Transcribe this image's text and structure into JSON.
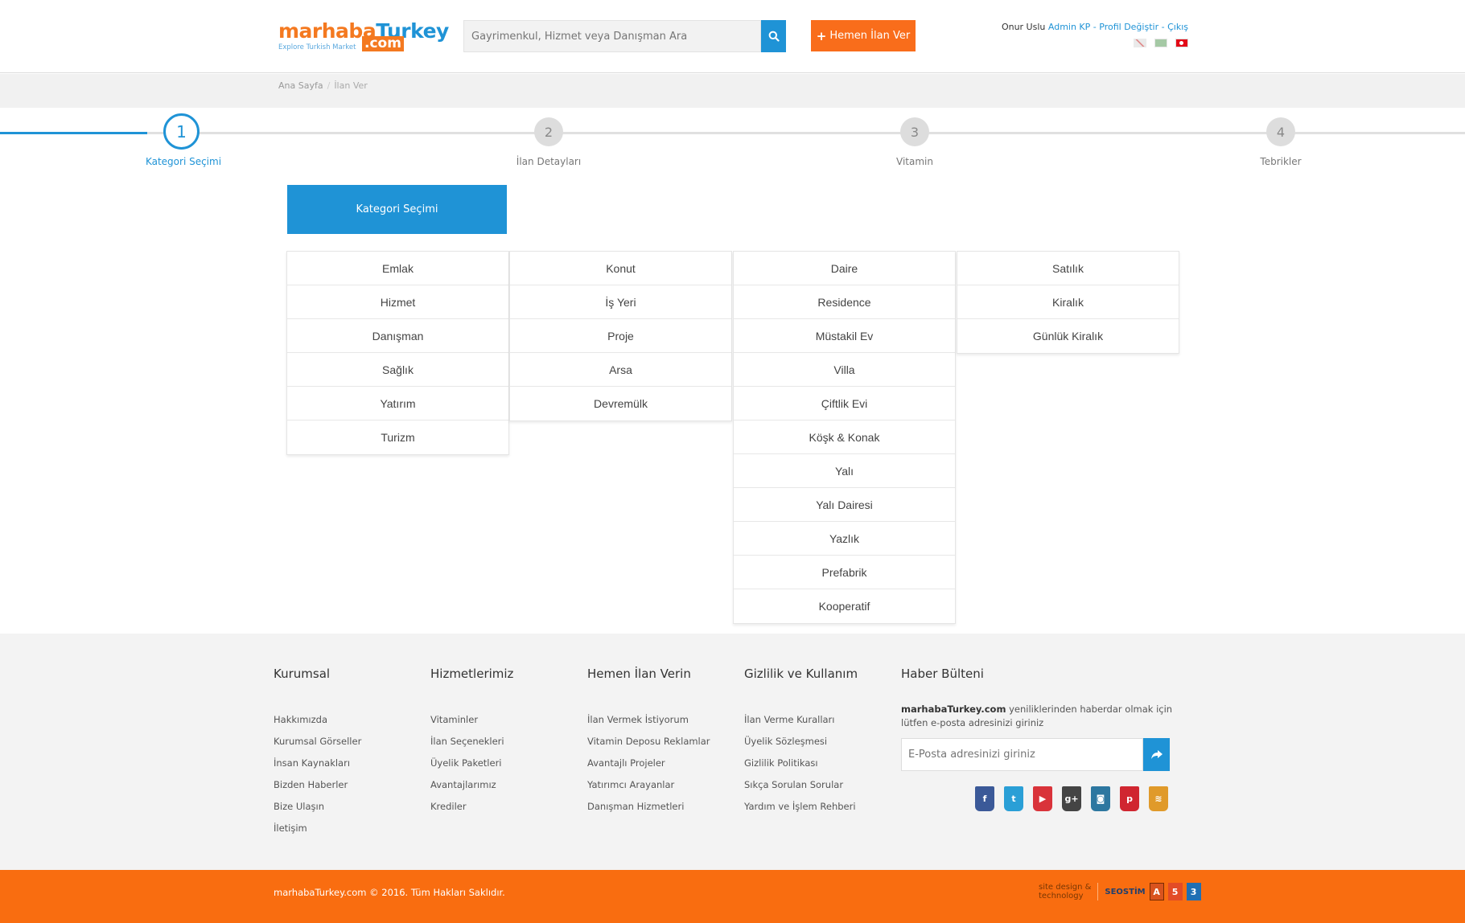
{
  "header": {
    "logo": {
      "part1": "marhaba",
      "part2": "Turkey",
      "suffix": ".com",
      "tagline": "Explore Turkish Market"
    },
    "search_placeholder": "Gayrimenkul, Hizmet veya Danışman Ara",
    "post_button": "Hemen İlan Ver",
    "user": {
      "name": "Onur Uslu",
      "admin": "Admin KP",
      "profile": "Profil Değiştir",
      "logout": "Çıkış",
      "sep": "-"
    }
  },
  "breadcrumb": {
    "home": "Ana Sayfa",
    "sep": "/",
    "current": "İlan Ver"
  },
  "steps": [
    {
      "num": "1",
      "label": "Kategori Seçimi"
    },
    {
      "num": "2",
      "label": "İlan Detayları"
    },
    {
      "num": "3",
      "label": "Vitamin"
    },
    {
      "num": "4",
      "label": "Tebrikler"
    }
  ],
  "category_title": "Kategori Seçimi",
  "columns": [
    [
      "Emlak",
      "Hizmet",
      "Danışman",
      "Sağlık",
      "Yatırım",
      "Turizm"
    ],
    [
      "Konut",
      "İş Yeri",
      "Proje",
      "Arsa",
      "Devremülk"
    ],
    [
      "Daire",
      "Residence",
      "Müstakil Ev",
      "Villa",
      "Çiftlik Evi",
      "Köşk & Konak",
      "Yalı",
      "Yalı Dairesi",
      "Yazlık",
      "Prefabrik",
      "Kooperatif"
    ],
    [
      "Satılık",
      "Kiralık",
      "Günlük Kiralık"
    ]
  ],
  "footer": {
    "kurumsal": {
      "title": "Kurumsal",
      "items": [
        "Hakkımızda",
        "Kurumsal Görseller",
        "İnsan Kaynakları",
        "Bizden Haberler",
        "Bize Ulaşın",
        "İletişim"
      ]
    },
    "hizmetler": {
      "title": "Hizmetlerimiz",
      "items": [
        "Vitaminler",
        "İlan Seçenekleri",
        "Üyelik Paketleri",
        "Avantajlarımız",
        "Krediler"
      ]
    },
    "ilan": {
      "title": "Hemen İlan Verin",
      "items": [
        "İlan Vermek İstiyorum",
        "Vitamin Deposu Reklamlar",
        "Avantajlı Projeler",
        "Yatırımcı Arayanlar",
        "Danışman Hizmetleri"
      ]
    },
    "gizlilik": {
      "title": "Gizlilik ve Kullanım",
      "items": [
        "İlan Verme Kuralları",
        "Üyelik Sözleşmesi",
        "Gizlilik Politikası",
        "Sıkça Sorulan Sorular",
        "Yardım ve İşlem Rehberi"
      ]
    },
    "newsletter": {
      "title": "Haber Bülteni",
      "brand": "marhabaTurkey.com",
      "text": " yeniliklerinden haberdar olmak için lütfen e-posta adresinizi giriniz",
      "placeholder": "E-Posta adresinizi giriniz"
    },
    "socials": [
      {
        "icon": "facebook-icon",
        "glyph": "f",
        "color": "#3b5998"
      },
      {
        "icon": "twitter-icon",
        "glyph": "t",
        "color": "#2a9fd6"
      },
      {
        "icon": "youtube-icon",
        "glyph": "▶",
        "color": "#d9333a"
      },
      {
        "icon": "google-plus-icon",
        "glyph": "g+",
        "color": "#444444"
      },
      {
        "icon": "instagram-icon",
        "glyph": "◙",
        "color": "#2d77a0"
      },
      {
        "icon": "pinterest-icon",
        "glyph": "p",
        "color": "#d02630"
      },
      {
        "icon": "rss-icon",
        "glyph": "≋",
        "color": "#e09a2a"
      }
    ]
  },
  "bottom": {
    "copyright": "marhabaTurkey.com © 2016. Tüm Hakları Saklıdır.",
    "design1": "site design &",
    "design2": "technology",
    "brand": "SEOSTİM"
  },
  "colors": {
    "primary": "#1f93d6",
    "accent": "#f96d1b"
  }
}
